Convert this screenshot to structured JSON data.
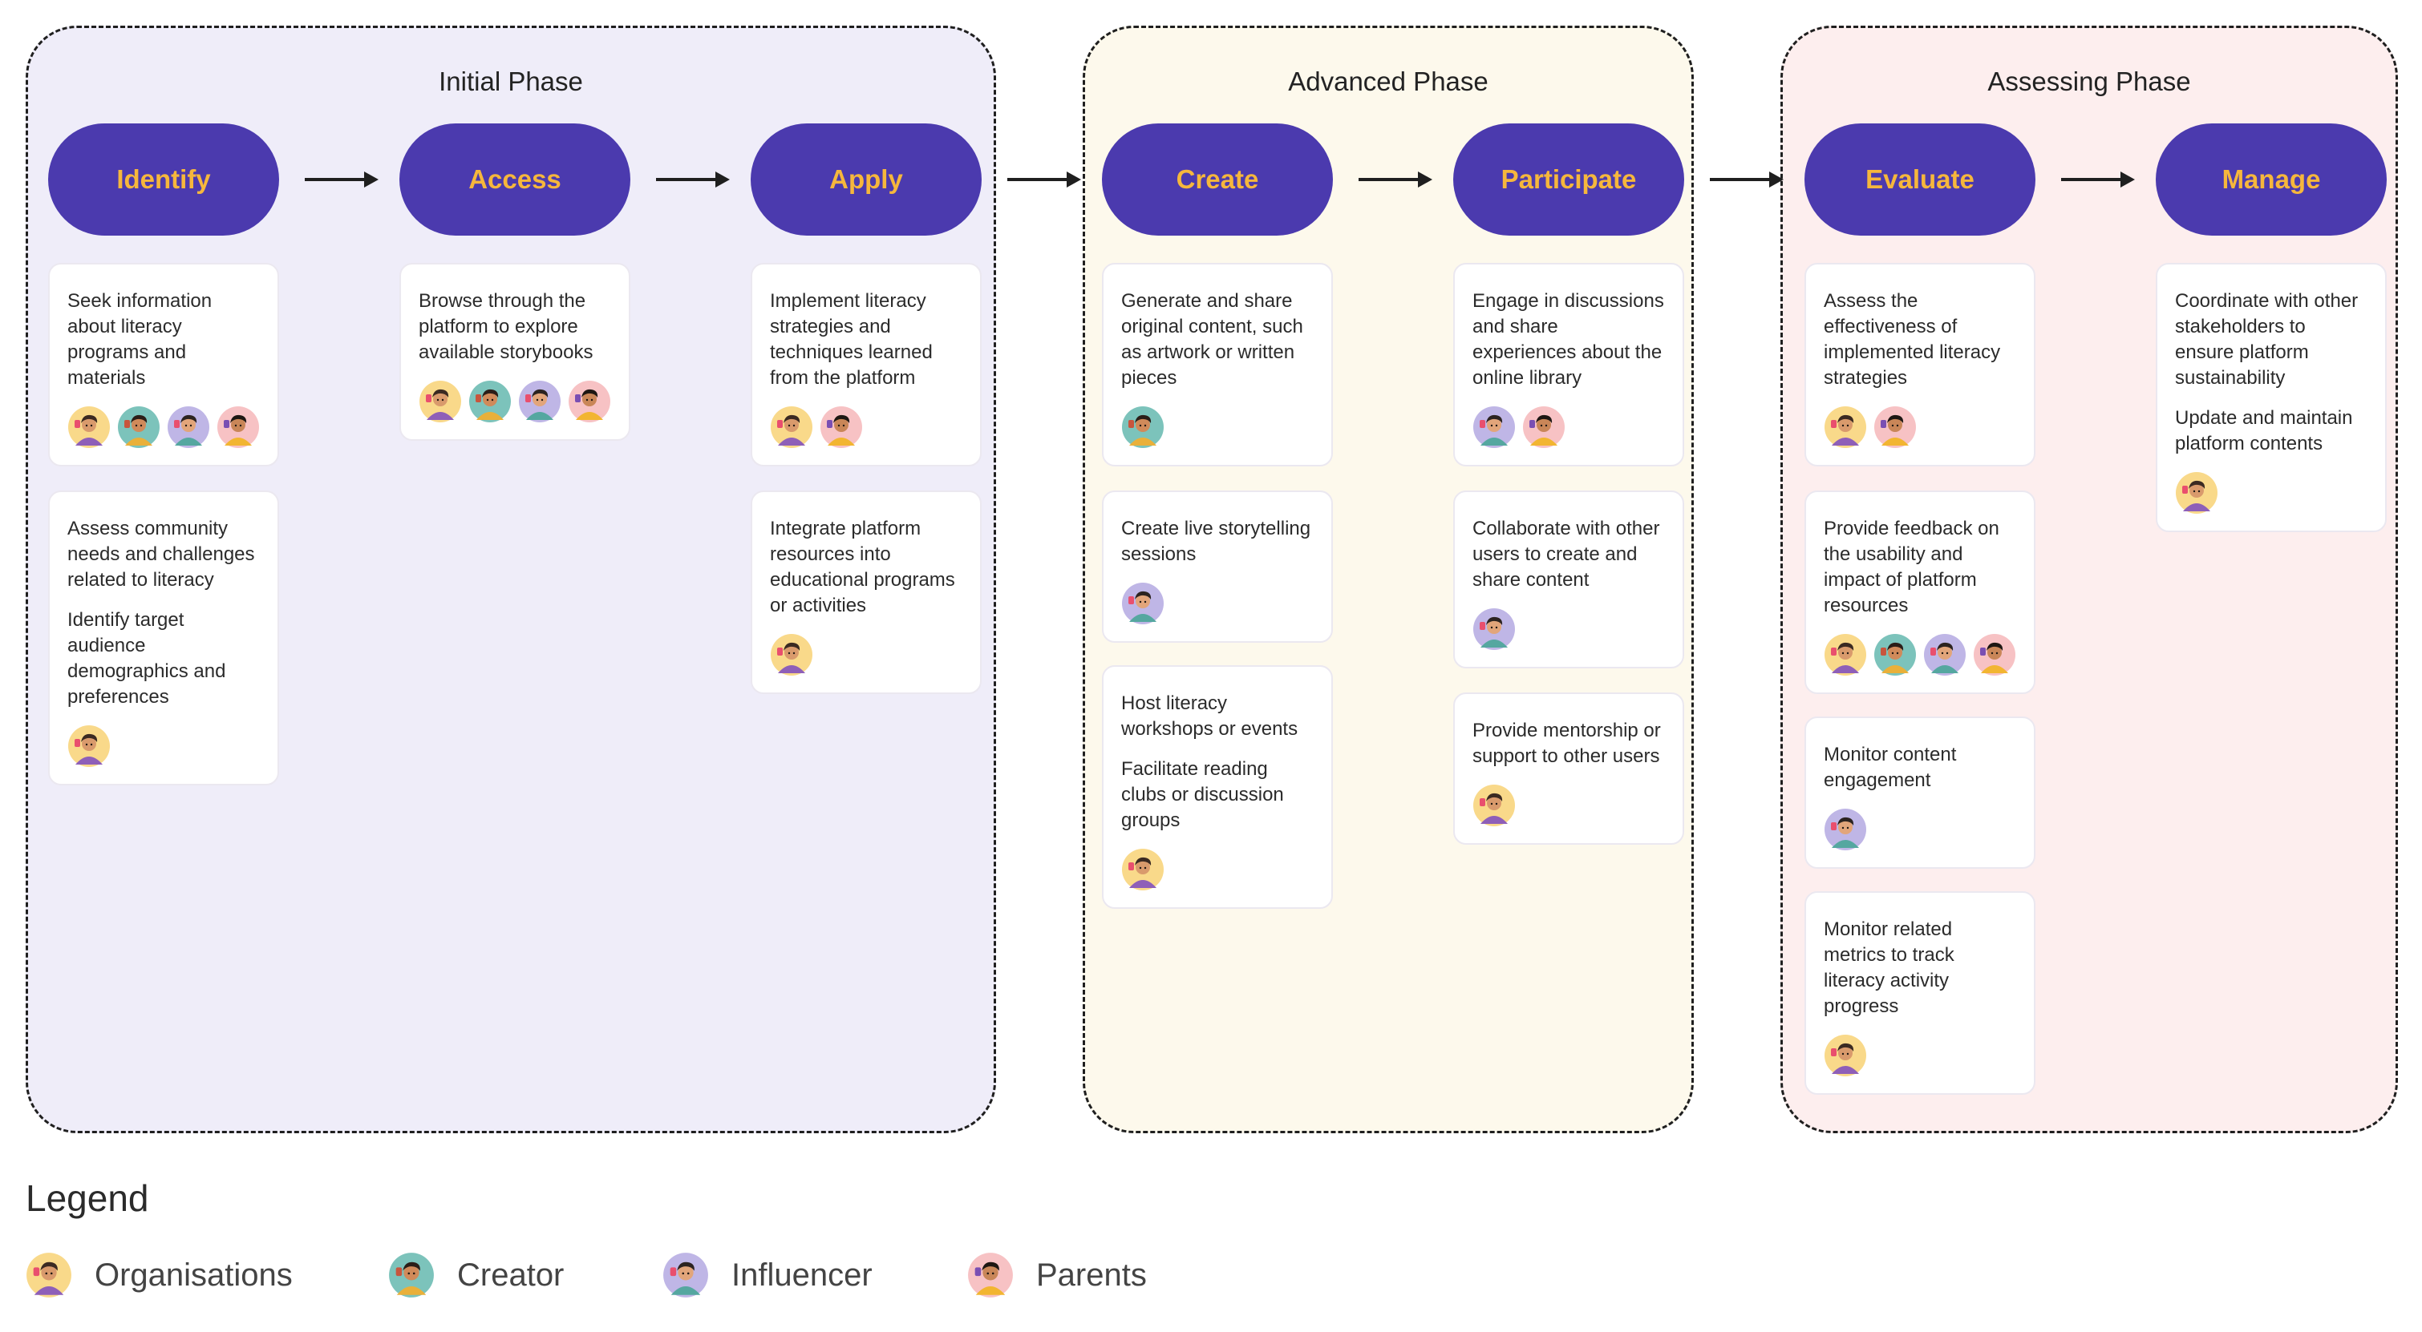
{
  "phases": {
    "initial": "Initial Phase",
    "advanced": "Advanced Phase",
    "assessing": "Assessing Phase"
  },
  "stages": [
    "Identify",
    "Access",
    "Apply",
    "Create",
    "Participate",
    "Evaluate",
    "Manage"
  ],
  "cards": [
    {
      "stage": "Identify",
      "texts": [
        "Seek information about literacy programs and materials"
      ],
      "avatars": [
        "organisations",
        "creator",
        "influencer",
        "parents"
      ]
    },
    {
      "stage": "Identify",
      "texts": [
        "Assess community needs and challenges related to literacy",
        "Identify target audience demographics and preferences"
      ],
      "avatars": [
        "organisations"
      ]
    },
    {
      "stage": "Access",
      "texts": [
        "Browse through the platform to explore available storybooks"
      ],
      "avatars": [
        "organisations",
        "creator",
        "influencer",
        "parents"
      ]
    },
    {
      "stage": "Apply",
      "texts": [
        "Implement literacy strategies and techniques learned from the platform"
      ],
      "avatars": [
        "organisations",
        "parents"
      ]
    },
    {
      "stage": "Apply",
      "texts": [
        "Integrate platform resources into educational programs or activities"
      ],
      "avatars": [
        "organisations"
      ]
    },
    {
      "stage": "Create",
      "texts": [
        "Generate and share original content, such as artwork or written pieces"
      ],
      "avatars": [
        "creator"
      ]
    },
    {
      "stage": "Create",
      "texts": [
        "Create live storytelling sessions"
      ],
      "avatars": [
        "influencer"
      ]
    },
    {
      "stage": "Create",
      "texts": [
        "Host literacy workshops or events",
        "Facilitate reading clubs or discussion groups"
      ],
      "avatars": [
        "organisations"
      ]
    },
    {
      "stage": "Participate",
      "texts": [
        "Engage in discussions and share experiences about the online library"
      ],
      "avatars": [
        "influencer",
        "parents"
      ]
    },
    {
      "stage": "Participate",
      "texts": [
        "Collaborate with other users to create and share content"
      ],
      "avatars": [
        "influencer"
      ]
    },
    {
      "stage": "Participate",
      "texts": [
        "Provide mentorship or support to other users"
      ],
      "avatars": [
        "organisations"
      ]
    },
    {
      "stage": "Evaluate",
      "texts": [
        "Assess the effectiveness of implemented literacy strategies"
      ],
      "avatars": [
        "organisations",
        "parents"
      ]
    },
    {
      "stage": "Evaluate",
      "texts": [
        "Provide feedback on the usability and impact of platform resources"
      ],
      "avatars": [
        "organisations",
        "creator",
        "influencer",
        "parents"
      ]
    },
    {
      "stage": "Evaluate",
      "texts": [
        "Monitor content engagement"
      ],
      "avatars": [
        "influencer"
      ]
    },
    {
      "stage": "Evaluate",
      "texts": [
        "Monitor related metrics to track literacy activity progress"
      ],
      "avatars": [
        "organisations"
      ]
    },
    {
      "stage": "Manage",
      "texts": [
        "Coordinate with other stakeholders to ensure platform sustainability",
        "Update and maintain platform contents"
      ],
      "avatars": [
        "organisations"
      ]
    }
  ],
  "legend": {
    "title": "Legend",
    "items": [
      "Organisations",
      "Creator",
      "Influencer",
      "Parents"
    ]
  },
  "avatar_colors": {
    "organisations": "#f9d98a",
    "creator": "#7cc3bb",
    "influencer": "#bfb6e6",
    "parents": "#f7c2c4"
  },
  "colors": {
    "pill_bg": "#4b3aae",
    "pill_text": "#f6b73c",
    "initial_bg": "#efedf9",
    "advanced_bg": "#fdf9ec",
    "assessing_bg": "#fdeeee"
  }
}
